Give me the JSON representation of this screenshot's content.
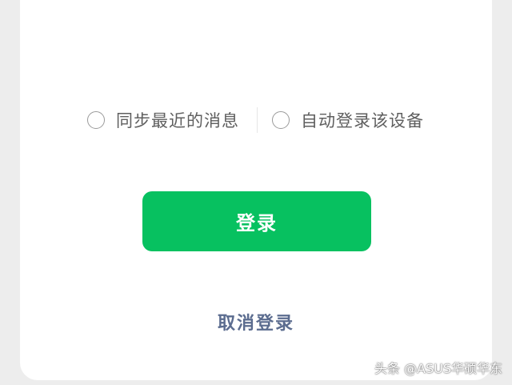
{
  "options": {
    "sync_recent_messages": {
      "label": "同步最近的消息",
      "checked": false
    },
    "auto_login_device": {
      "label": "自动登录该设备",
      "checked": false
    }
  },
  "actions": {
    "login_label": "登录",
    "cancel_login_label": "取消登录"
  },
  "watermark": {
    "text": "头条 @ASUS华硕华东"
  },
  "colors": {
    "primary_green": "#07c160",
    "link_blue": "#5b6c8f",
    "card_background": "#ffffff",
    "page_background": "#ededed"
  }
}
